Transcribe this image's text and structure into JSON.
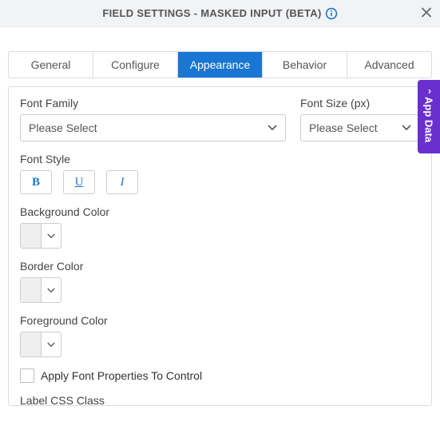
{
  "header": {
    "title": "FIELD SETTINGS - MASKED INPUT (BETA)"
  },
  "tabs": {
    "items": [
      {
        "label": "General"
      },
      {
        "label": "Configure"
      },
      {
        "label": "Appearance"
      },
      {
        "label": "Behavior"
      },
      {
        "label": "Advanced"
      }
    ],
    "active_index": 2
  },
  "form": {
    "font_family": {
      "label": "Font Family",
      "value": "Please Select"
    },
    "font_size": {
      "label": "Font Size (px)",
      "value": "Please Select"
    },
    "font_style": {
      "label": "Font Style",
      "bold": "B",
      "underline": "U",
      "italic": "I"
    },
    "background_color": {
      "label": "Background Color"
    },
    "border_color": {
      "label": "Border Color"
    },
    "foreground_color": {
      "label": "Foreground Color"
    },
    "apply_font": {
      "label": "Apply Font Properties To Control",
      "checked": false
    },
    "label_css": {
      "label": "Label CSS Class",
      "value": ""
    }
  },
  "side_tab": {
    "label": "App Data"
  },
  "colors": {
    "accent": "#1976d2",
    "side": "#6a2fce"
  }
}
